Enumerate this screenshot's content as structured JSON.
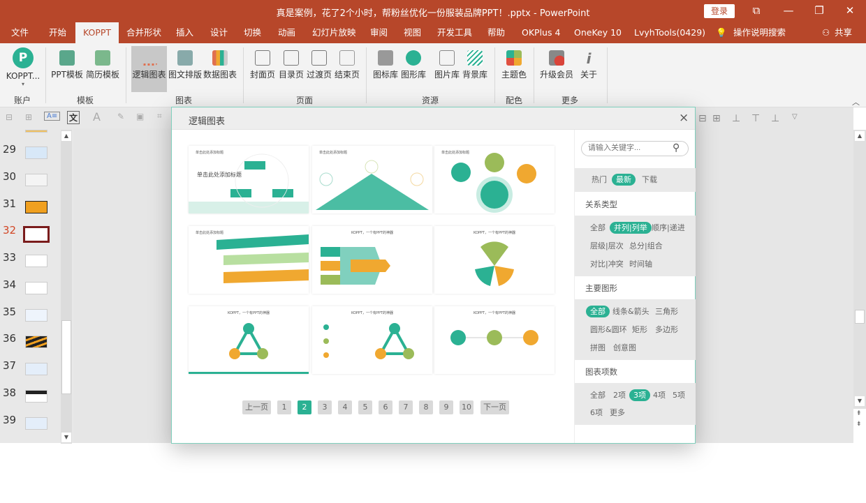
{
  "titlebar": {
    "title": "真是案例，花了2个小时，帮粉丝优化一份服装品牌PPT！.pptx  -  PowerPoint",
    "login": "登录",
    "ribbon_display": "⧉",
    "minimize": "—",
    "restore": "❐",
    "close": "✕"
  },
  "tabs": [
    "文件",
    "开始",
    "KOPPT",
    "合并形状",
    "插入",
    "设计",
    "切换",
    "动画",
    "幻灯片放映",
    "审阅",
    "视图",
    "开发工具",
    "帮助",
    "OKPlus 4",
    "OneKey 10",
    "LvyhTools(0429)"
  ],
  "tell_me": "操作说明搜索",
  "share": "共享",
  "ribbon": {
    "account": {
      "label": "KOPPT...",
      "group": "账户"
    },
    "template": {
      "items": [
        "PPT模板",
        "简历模板"
      ],
      "group": "模板"
    },
    "chart": {
      "items": [
        "逻辑图表",
        "图文排版",
        "数据图表"
      ],
      "group": "图表"
    },
    "page": {
      "items": [
        "封面页",
        "目录页",
        "过渡页",
        "结束页"
      ],
      "group": "页面"
    },
    "resource": {
      "items": [
        "图标库",
        "图形库",
        "图片库",
        "背景库"
      ],
      "group": "资源"
    },
    "color": {
      "items": [
        "主题色"
      ],
      "group": "配色"
    },
    "more": {
      "items": [
        "升级会员",
        "关于"
      ],
      "group": "更多"
    }
  },
  "slides": {
    "numbers": [
      "29",
      "30",
      "31",
      "32",
      "33",
      "34",
      "35",
      "36",
      "37",
      "38",
      "39"
    ],
    "current": "32"
  },
  "dialog": {
    "title": "逻辑图表",
    "close": "×",
    "cards": [
      {
        "title": "单击此处添加标题",
        "subtitle": "单击此处添加标题"
      },
      {
        "title": "单击此处添加标题"
      },
      {
        "title": "单击此处添加标题"
      },
      {
        "title": "单击此处添加标题"
      },
      {
        "title": "KOPPT，一个有PPT的神器"
      },
      {
        "title": "KOPPT，一个有PPT的神器"
      },
      {
        "title": "KOPPT，一个有PPT的神器"
      },
      {
        "title": "KOPPT，一个有PPT的神器"
      },
      {
        "title": "KOPPT，一个有PPT的神器"
      }
    ],
    "pagination": {
      "prev": "上一页",
      "pages": [
        "1",
        "2",
        "3",
        "4",
        "5",
        "6",
        "7",
        "8",
        "9",
        "10"
      ],
      "current": "2",
      "next": "下一页"
    },
    "sidebar": {
      "search_placeholder": "请输入关键字...",
      "sort": [
        "热门",
        "最新",
        "下载"
      ],
      "relation_title": "关系类型",
      "relation": [
        "全部",
        "并列|列举",
        "顺序|递进",
        "层级|层次",
        "总分|组合",
        "对比|冲突",
        "时间轴"
      ],
      "shape_title": "主要图形",
      "shape": [
        "全部",
        "线条&箭头",
        "三角形",
        "圆形&圆环",
        "矩形",
        "多边形",
        "拼图",
        "创意图"
      ],
      "count_title": "图表项数",
      "count": [
        "全部",
        "2项",
        "3项",
        "4项",
        "5项",
        "6项",
        "更多"
      ]
    }
  },
  "colors": {
    "brand": "#B7472A",
    "accent": "#2bb193",
    "orange": "#f0a830",
    "green": "#9bbb59"
  }
}
